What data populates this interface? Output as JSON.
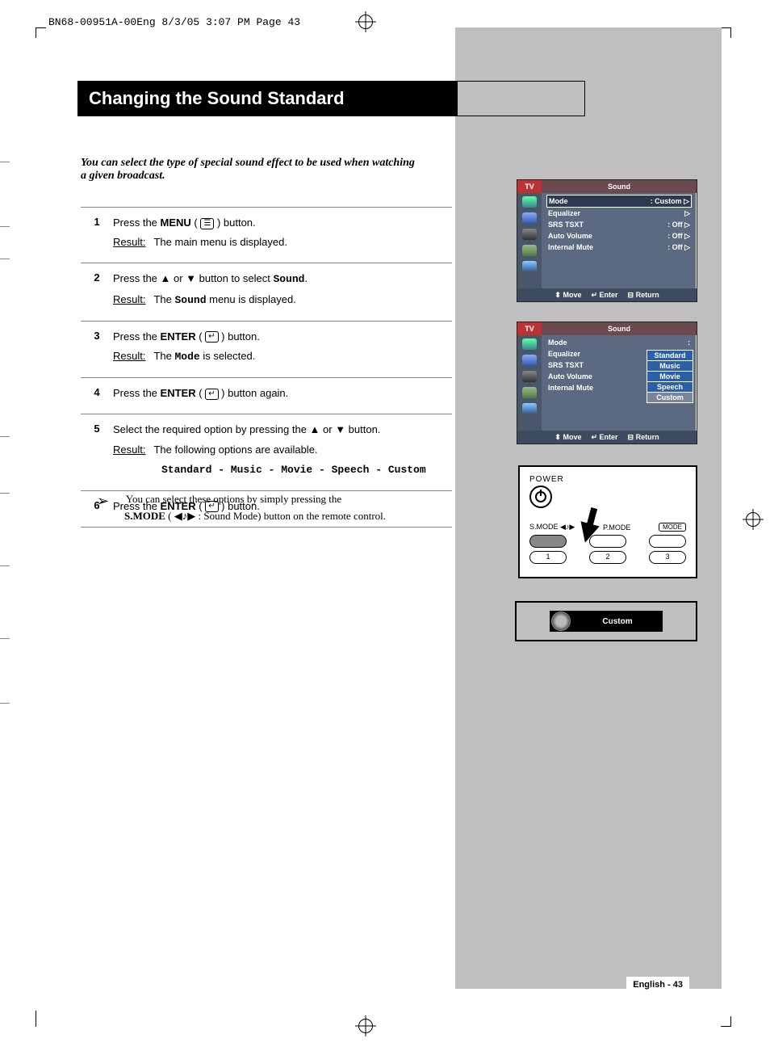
{
  "header": "BN68-00951A-00Eng  8/3/05  3:07 PM  Page 43",
  "title": "Changing the Sound Standard",
  "intro": "You can select the type of special sound effect to be used when watching a given broadcast.",
  "resultLabel": "Result:",
  "steps": [
    {
      "num": "1",
      "line1a": "Press the ",
      "bold1": "MENU",
      "line1b": " ( ",
      "line1c": " ) button.",
      "result": "The main menu is displayed."
    },
    {
      "num": "2",
      "line1a": "Press the ▲ or ▼ button to select ",
      "mono1": "Sound",
      "line1b": ".",
      "result_a": "The ",
      "result_mono": "Sound",
      "result_b": " menu is displayed."
    },
    {
      "num": "3",
      "line1a": "Press the ",
      "bold1": "ENTER",
      "line1b": " ( ",
      "line1c": " ) button.",
      "result_a": "The ",
      "result_mono": "Mode",
      "result_b": " is selected."
    },
    {
      "num": "4",
      "line1a": "Press the ",
      "bold1": "ENTER",
      "line1b": " ( ",
      "line1c": " ) button again."
    },
    {
      "num": "5",
      "line1a": "Select the required option by pressing the ▲ or ▼ button.",
      "result": "The following options are available.",
      "options": "Standard - Music - Movie - Speech - Custom"
    },
    {
      "num": "6",
      "line1a": "Press the ",
      "bold1": "ENTER",
      "line1b": " ( ",
      "line1c": " ) button."
    }
  ],
  "note": {
    "arrow": "➢",
    "line1": "You can select these options by simply pressing the",
    "bold": "S.MODE",
    "line2": " ( ◀♪▶ : Sound Mode) button on the remote control."
  },
  "osd": {
    "tv": "TV",
    "title": "Sound",
    "rows1": [
      {
        "label": "Mode",
        "value": ":  Custom",
        "sel": true
      },
      {
        "label": "Equalizer",
        "value": ""
      },
      {
        "label": "SRS TSXT",
        "value": ":  Off"
      },
      {
        "label": "Auto Volume",
        "value": ":  Off"
      },
      {
        "label": "Internal Mute",
        "value": ":  Off"
      }
    ],
    "rows2": [
      {
        "label": "Mode",
        "value": ":"
      },
      {
        "label": "Equalizer",
        "value": ":"
      },
      {
        "label": "SRS TSXT",
        "value": ":"
      },
      {
        "label": "Auto Volume",
        "value": ":"
      },
      {
        "label": "Internal Mute",
        "value": ":"
      }
    ],
    "options": [
      "Standard",
      "Music",
      "Movie",
      "Speech",
      "Custom"
    ],
    "footer": {
      "move": "Move",
      "enter": "Enter",
      "return": "Return"
    }
  },
  "remote": {
    "power": "POWER",
    "smode": "S.MODE ◀♪▶",
    "pmode": "P.MODE",
    "mode": "MODE",
    "n1": "1",
    "n2": "2",
    "n3": "3"
  },
  "customBar": "Custom",
  "footer": "English - 43"
}
